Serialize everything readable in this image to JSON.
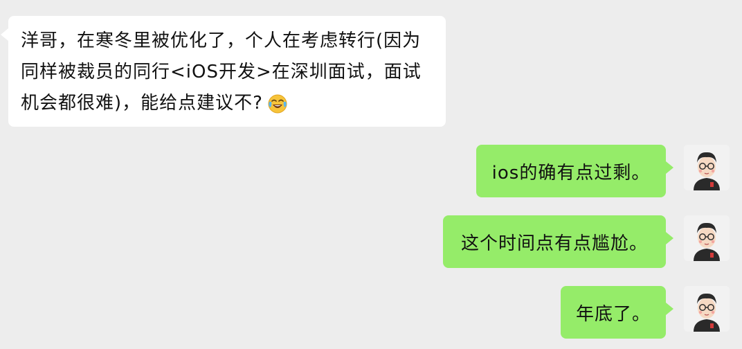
{
  "messages": {
    "incoming": {
      "text": "洋哥，在寒冬里被优化了，个人在考虑转行(因为同样被裁员的同行<iOS开发>在深圳面试，面试机会都很难)，能给点建议不?",
      "emoji": "tears-of-joy-emoji"
    },
    "outgoing": [
      {
        "text": "ios的确有点过剩。"
      },
      {
        "text": "这个时间点有点尴尬。"
      },
      {
        "text": "年底了。"
      }
    ]
  },
  "colors": {
    "background": "#ededed",
    "incoming_bubble": "#ffffff",
    "outgoing_bubble": "#95ec69",
    "text": "#111111"
  }
}
